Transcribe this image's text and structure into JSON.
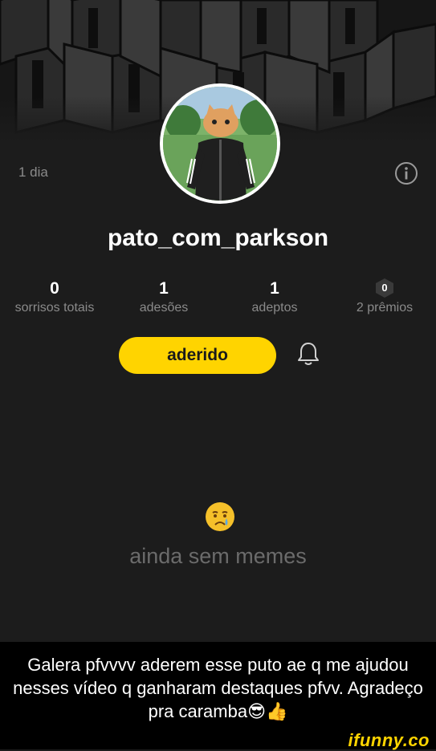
{
  "profile": {
    "joined": "1 dia",
    "username": "pato_com_parkson",
    "follow_button": "aderido"
  },
  "stats": [
    {
      "value": "0",
      "label": "sorrisos totais"
    },
    {
      "value": "1",
      "label": "adesões"
    },
    {
      "value": "1",
      "label": "adeptos"
    },
    {
      "value": "0",
      "label": "2 prêmios"
    }
  ],
  "empty_state": {
    "emoji": "crying-face",
    "text": "ainda sem memes"
  },
  "caption": {
    "text": "Galera pfvvvv aderem esse puto ae q me ajudou nesses vídeo q ganharam destaques pfvv. Agradeço pra caramba😎👍"
  },
  "watermark": "ifunny.co",
  "colors": {
    "accent": "#ffd400",
    "background": "#1c1c1c",
    "muted_text": "#8a8a8a"
  },
  "icons": {
    "info": "info-icon",
    "bell": "bell-icon"
  }
}
